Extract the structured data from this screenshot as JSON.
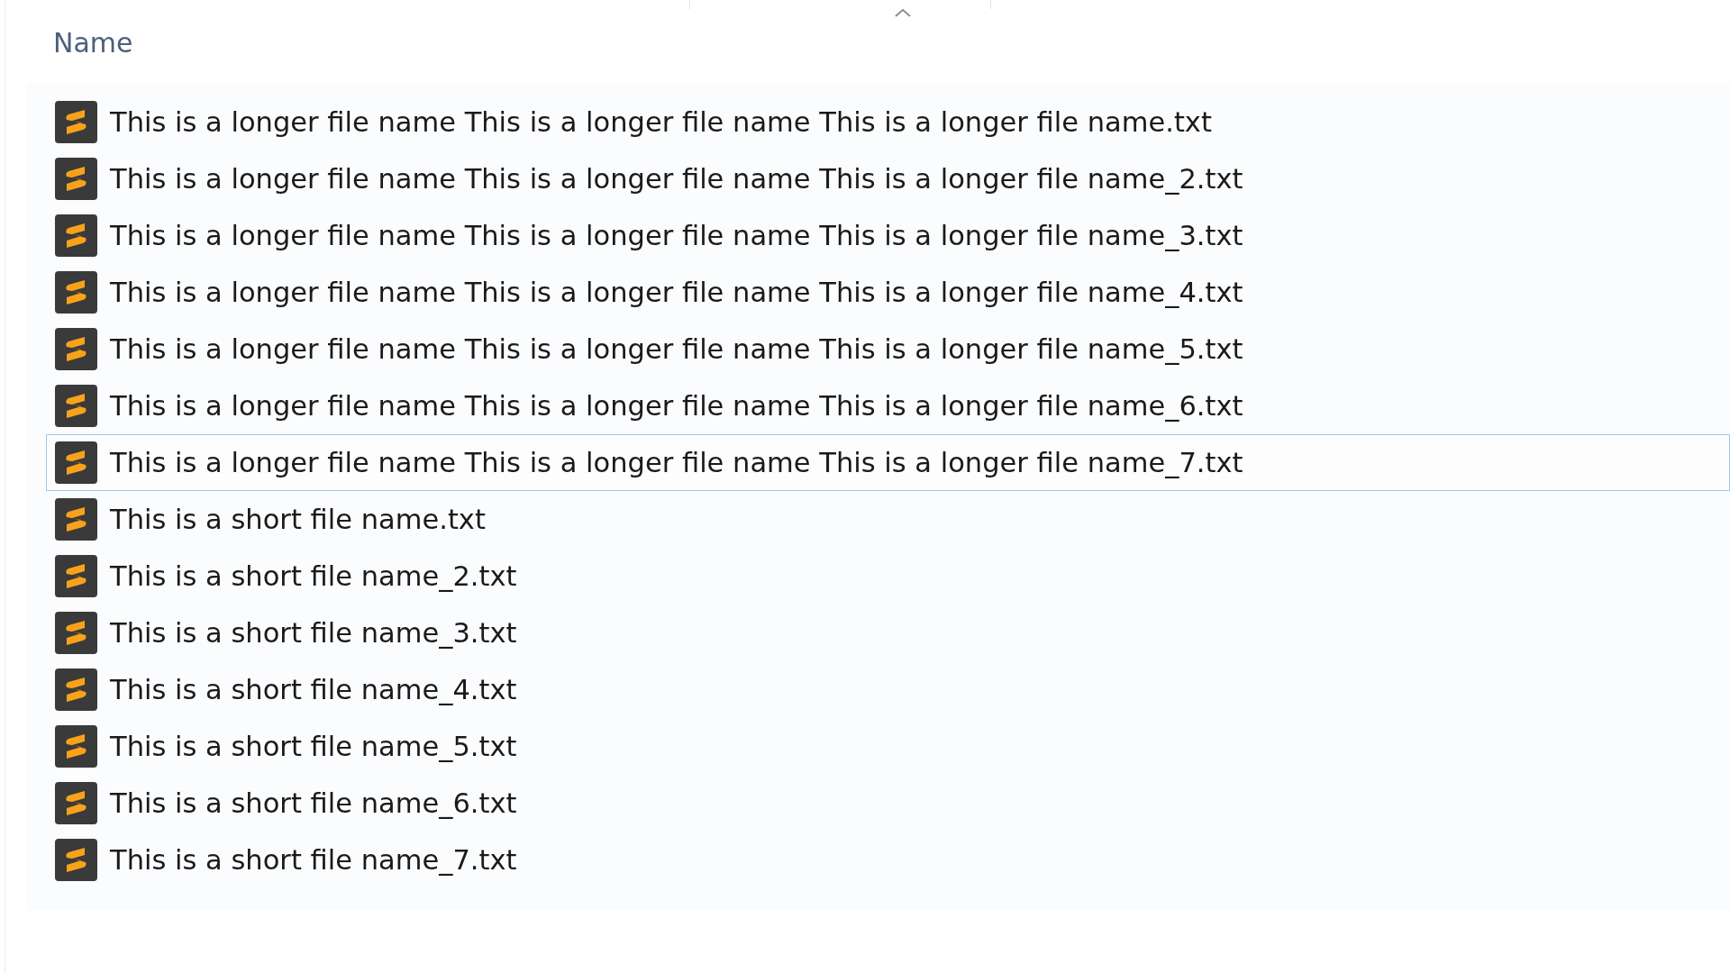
{
  "column_header": {
    "label": "Name",
    "sorted": true
  },
  "files": [
    {
      "name": "This is a longer file name This is a longer file name This is a longer file name.txt",
      "focused": false
    },
    {
      "name": "This is a longer file name This is a longer file name This is a longer file name_2.txt",
      "focused": false
    },
    {
      "name": "This is a longer file name This is a longer file name This is a longer file name_3.txt",
      "focused": false
    },
    {
      "name": "This is a longer file name This is a longer file name This is a longer file name_4.txt",
      "focused": false
    },
    {
      "name": "This is a longer file name This is a longer file name This is a longer file name_5.txt",
      "focused": false
    },
    {
      "name": "This is a longer file name This is a longer file name This is a longer file name_6.txt",
      "focused": false
    },
    {
      "name": "This is a longer file name This is a longer file name This is a longer file name_7.txt",
      "focused": true
    },
    {
      "name": "This is a short file name.txt",
      "focused": false
    },
    {
      "name": "This is a short file name_2.txt",
      "focused": false
    },
    {
      "name": "This is a short file name_3.txt",
      "focused": false
    },
    {
      "name": "This is a short file name_4.txt",
      "focused": false
    },
    {
      "name": "This is a short file name_5.txt",
      "focused": false
    },
    {
      "name": "This is a short file name_6.txt",
      "focused": false
    },
    {
      "name": "This is a short file name_7.txt",
      "focused": false
    }
  ]
}
